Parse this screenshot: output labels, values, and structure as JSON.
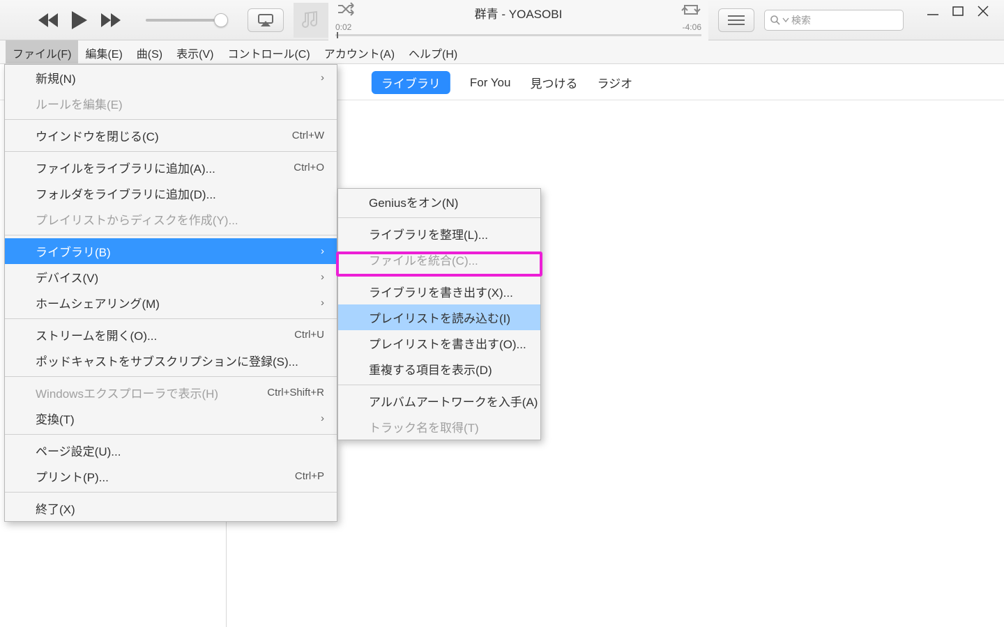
{
  "now_playing": {
    "title": "群青 - YOASOBI",
    "elapsed": "0:02",
    "remaining": "-4:06"
  },
  "search": {
    "placeholder": "検索"
  },
  "menubar": [
    "ファイル(F)",
    "編集(E)",
    "曲(S)",
    "表示(V)",
    "コントロール(C)",
    "アカウント(A)",
    "ヘルプ(H)"
  ],
  "subnav": {
    "library": "ライブラリ",
    "for_you": "For You",
    "browse": "見つける",
    "radio": "ラジオ"
  },
  "file_menu": {
    "new": "新規(N)",
    "edit_rules": "ルールを編集(E)",
    "close_window": "ウインドウを閉じる(C)",
    "close_window_sc": "Ctrl+W",
    "add_file": "ファイルをライブラリに追加(A)...",
    "add_file_sc": "Ctrl+O",
    "add_folder": "フォルダをライブラリに追加(D)...",
    "burn": "プレイリストからディスクを作成(Y)...",
    "library": "ライブラリ(B)",
    "device": "デバイス(V)",
    "home_sharing": "ホームシェアリング(M)",
    "open_stream": "ストリームを開く(O)...",
    "open_stream_sc": "Ctrl+U",
    "subscribe_podcast": "ポッドキャストをサブスクリプションに登録(S)...",
    "show_explorer": "Windowsエクスプローラで表示(H)",
    "show_explorer_sc": "Ctrl+Shift+R",
    "convert": "変換(T)",
    "page_setup": "ページ設定(U)...",
    "print": "プリント(P)...",
    "print_sc": "Ctrl+P",
    "exit": "終了(X)"
  },
  "library_submenu": {
    "genius_on": "Geniusをオン(N)",
    "organize": "ライブラリを整理(L)...",
    "consolidate": "ファイルを統合(C)...",
    "export_library": "ライブラリを書き出す(X)...",
    "import_playlist": "プレイリストを読み込む(I)",
    "export_playlist": "プレイリストを書き出す(O)...",
    "show_duplicates": "重複する項目を表示(D)",
    "get_artwork": "アルバムアートワークを入手(A)",
    "get_track_names": "トラック名を取得(T)"
  }
}
